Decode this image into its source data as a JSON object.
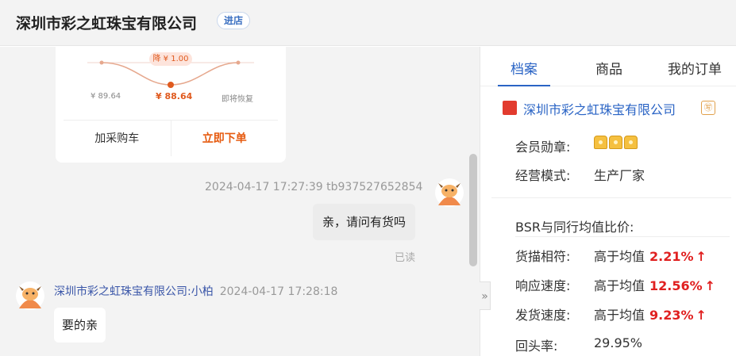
{
  "header": {
    "shop_name": "深圳市彩之虹珠宝有限公司",
    "enter_store_label": "进店"
  },
  "product_card": {
    "price_drop_badge": "降 ¥ 1.00",
    "price_prev": "¥ 89.64",
    "price_current": "¥ 88.64",
    "price_restore": "即将恢复",
    "add_to_cart_label": "加采购车",
    "buy_now_label": "立即下单"
  },
  "messages": [
    {
      "meta": "2024-04-17 17:27:39  tb937527652854",
      "text": "亲，请问有货吗",
      "status": "已读",
      "avatar_icon": "bull-avatar-icon"
    },
    {
      "sender_name": "深圳市彩之虹珠宝有限公司:小柏",
      "time": "2024-04-17 17:28:18",
      "text": "要的亲",
      "avatar_icon": "bull-avatar-icon"
    }
  ],
  "collapse_icon": "double-chevron-right-icon",
  "panel": {
    "tabs": [
      "档案",
      "商品",
      "我的订单"
    ],
    "active_tab": "档案",
    "company_name": "深圳市彩之虹珠宝有限公司",
    "company_badge": "㊢",
    "member_medal_label": "会员勋章:",
    "business_mode_label": "经营模式:",
    "business_mode_value": "生产厂家",
    "bsr_title": "BSR与同行均值比价:",
    "metrics": [
      {
        "label": "货描相符:",
        "prefix": "高于均值",
        "value": "2.21%",
        "arrow": "↑"
      },
      {
        "label": "响应速度:",
        "prefix": "高于均值",
        "value": "12.56%",
        "arrow": "↑"
      },
      {
        "label": "发货速度:",
        "prefix": "高于均值",
        "value": "9.23%",
        "arrow": "↑"
      }
    ],
    "repeat_rate_label": "回头率:",
    "repeat_rate_value": "29.95%"
  },
  "colors": {
    "accent_blue": "#2a64c5",
    "price_orange": "#e05a1e",
    "highlight_red": "#e02020"
  }
}
